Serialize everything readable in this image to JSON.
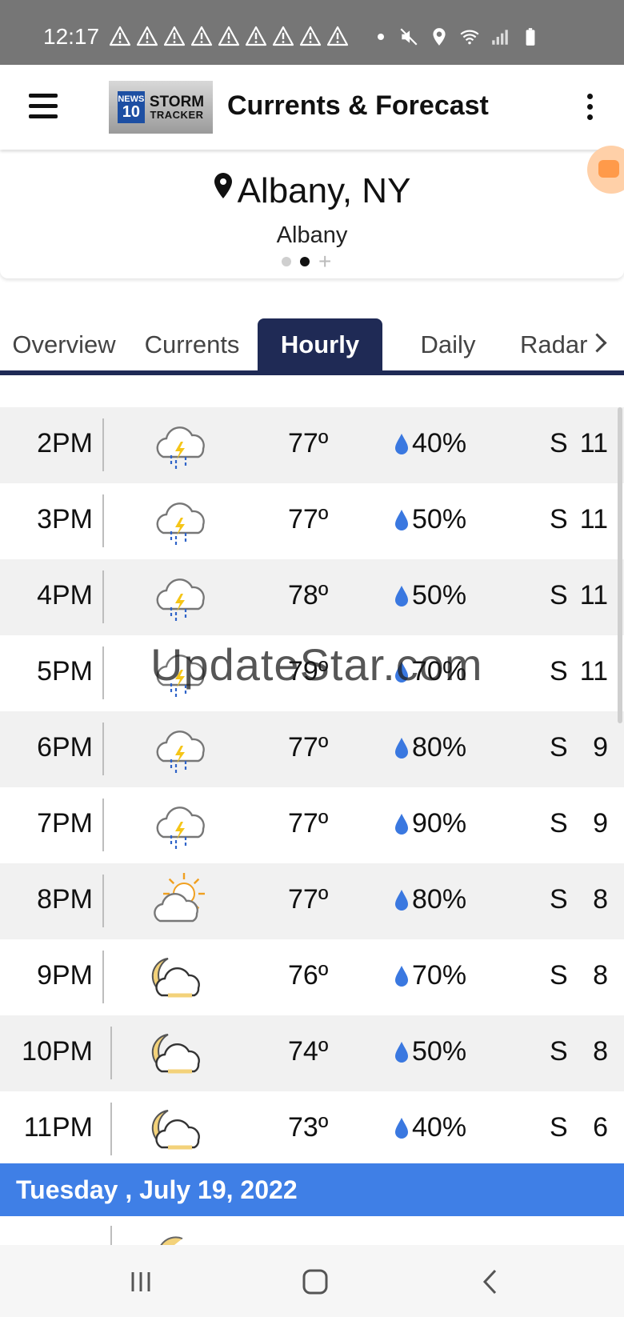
{
  "status": {
    "time": "12:17",
    "alert_count": 9,
    "icons": [
      "warning-icon",
      "mute-icon",
      "location-icon",
      "wifi-icon",
      "signal-icon",
      "battery-icon"
    ]
  },
  "appbar": {
    "logo": {
      "badge_top": "NEWS",
      "badge_num": "10",
      "line1": "STORM",
      "line2": "TRACKER"
    },
    "title": "Currents & Forecast"
  },
  "location": {
    "title": "Albany, NY",
    "subtitle": "Albany",
    "pages": 2,
    "active_page": 2
  },
  "tabs": [
    {
      "label": "Overview"
    },
    {
      "label": "Currents"
    },
    {
      "label": "Hourly",
      "active": true
    },
    {
      "label": "Daily"
    },
    {
      "label": "Radar"
    }
  ],
  "hourly": [
    {
      "time": "2PM",
      "icon": "thunderstorm-icon",
      "temp": "77º",
      "precip": "40%",
      "wind_dir": "S",
      "wind_speed": "11"
    },
    {
      "time": "3PM",
      "icon": "thunderstorm-icon",
      "temp": "77º",
      "precip": "50%",
      "wind_dir": "S",
      "wind_speed": "11"
    },
    {
      "time": "4PM",
      "icon": "thunderstorm-icon",
      "temp": "78º",
      "precip": "50%",
      "wind_dir": "S",
      "wind_speed": "11"
    },
    {
      "time": "5PM",
      "icon": "thunderstorm-icon",
      "temp": "79º",
      "precip": "70%",
      "wind_dir": "S",
      "wind_speed": "11"
    },
    {
      "time": "6PM",
      "icon": "thunderstorm-icon",
      "temp": "77º",
      "precip": "80%",
      "wind_dir": "S",
      "wind_speed": "9"
    },
    {
      "time": "7PM",
      "icon": "thunderstorm-icon",
      "temp": "77º",
      "precip": "90%",
      "wind_dir": "S",
      "wind_speed": "9"
    },
    {
      "time": "8PM",
      "icon": "partly-sunny-icon",
      "temp": "77º",
      "precip": "80%",
      "wind_dir": "S",
      "wind_speed": "8"
    },
    {
      "time": "9PM",
      "icon": "partly-cloudy-night-icon",
      "temp": "76º",
      "precip": "70%",
      "wind_dir": "S",
      "wind_speed": "8"
    },
    {
      "time": "10PM",
      "icon": "partly-cloudy-night-icon",
      "temp": "74º",
      "precip": "50%",
      "wind_dir": "S",
      "wind_speed": "8"
    },
    {
      "time": "11PM",
      "icon": "partly-cloudy-night-icon",
      "temp": "73º",
      "precip": "40%",
      "wind_dir": "S",
      "wind_speed": "6"
    }
  ],
  "day_header": "Tuesday , July 19, 2022",
  "watermark": "UpdateStar.com",
  "colors": {
    "tab_active": "#1f2a55",
    "day_header": "#3f7fe6",
    "drop": "#3a78e0",
    "bolt": "#f5c518",
    "moon": "#f3d27a"
  }
}
